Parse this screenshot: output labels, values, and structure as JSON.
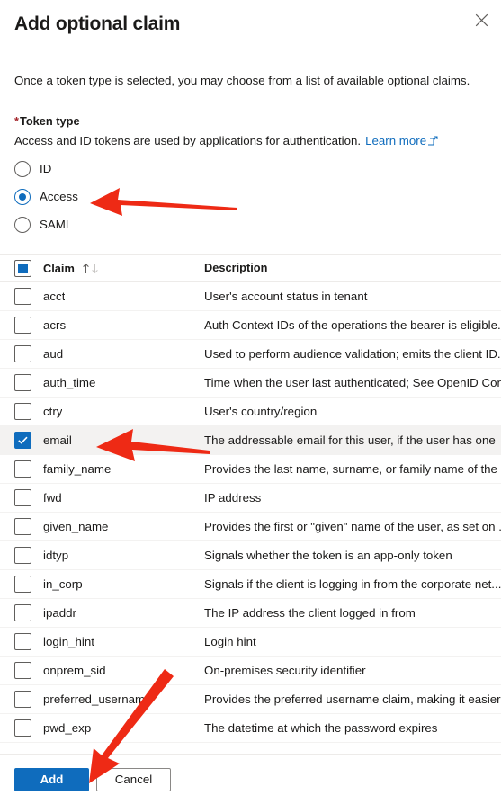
{
  "panel": {
    "title": "Add optional claim",
    "close_icon": "close-icon",
    "intro": "Once a token type is selected, you may choose from a list of available optional claims."
  },
  "token_type": {
    "required_marker": "*",
    "label": "Token type",
    "description": "Access and ID tokens are used by applications for authentication.",
    "learn_more_label": "Learn more",
    "learn_more_icon": "external-link-icon",
    "options": [
      {
        "label": "ID",
        "selected": false
      },
      {
        "label": "Access",
        "selected": true
      },
      {
        "label": "SAML",
        "selected": false
      }
    ]
  },
  "table": {
    "select_all_state": "indeterminate",
    "columns": [
      {
        "label": "Claim",
        "sortable": true,
        "sort_icon": "sort-arrows-icon"
      },
      {
        "label": "Description",
        "sortable": false
      }
    ],
    "rows": [
      {
        "claim": "acct",
        "description": "User's account status in tenant",
        "checked": false
      },
      {
        "claim": "acrs",
        "description": "Auth Context IDs of the operations the bearer is eligible...",
        "checked": false
      },
      {
        "claim": "aud",
        "description": "Used to perform audience validation; emits the client ID...",
        "checked": false
      },
      {
        "claim": "auth_time",
        "description": "Time when the user last authenticated; See OpenID Con...",
        "checked": false
      },
      {
        "claim": "ctry",
        "description": "User's country/region",
        "checked": false
      },
      {
        "claim": "email",
        "description": "The addressable email for this user, if the user has one",
        "checked": true
      },
      {
        "claim": "family_name",
        "description": "Provides the last name, surname, or family name of the ...",
        "checked": false
      },
      {
        "claim": "fwd",
        "description": "IP address",
        "checked": false
      },
      {
        "claim": "given_name",
        "description": "Provides the first or \"given\" name of the user, as set on ...",
        "checked": false
      },
      {
        "claim": "idtyp",
        "description": "Signals whether the token is an app-only token",
        "checked": false
      },
      {
        "claim": "in_corp",
        "description": "Signals if the client is logging in from the corporate net...",
        "checked": false
      },
      {
        "claim": "ipaddr",
        "description": "The IP address the client logged in from",
        "checked": false
      },
      {
        "claim": "login_hint",
        "description": "Login hint",
        "checked": false
      },
      {
        "claim": "onprem_sid",
        "description": "On-premises security identifier",
        "checked": false
      },
      {
        "claim": "preferred_username",
        "description": "Provides the preferred username claim, making it easier...",
        "checked": false
      },
      {
        "claim": "pwd_exp",
        "description": "The datetime at which the password expires",
        "checked": false
      }
    ]
  },
  "footer": {
    "add_label": "Add",
    "cancel_label": "Cancel"
  },
  "colors": {
    "accent": "#0f6cbd",
    "required": "#a4262c",
    "annotation": "#ee2a15",
    "row_selected_bg": "#f3f2f1",
    "border": "#edebe9"
  },
  "annotations": [
    {
      "name": "arrow-to-access-radio",
      "direction": "left",
      "target": "Access"
    },
    {
      "name": "arrow-to-email-row",
      "direction": "left",
      "target": "email"
    },
    {
      "name": "arrow-to-add-button",
      "direction": "down-left",
      "target": "Add"
    }
  ]
}
